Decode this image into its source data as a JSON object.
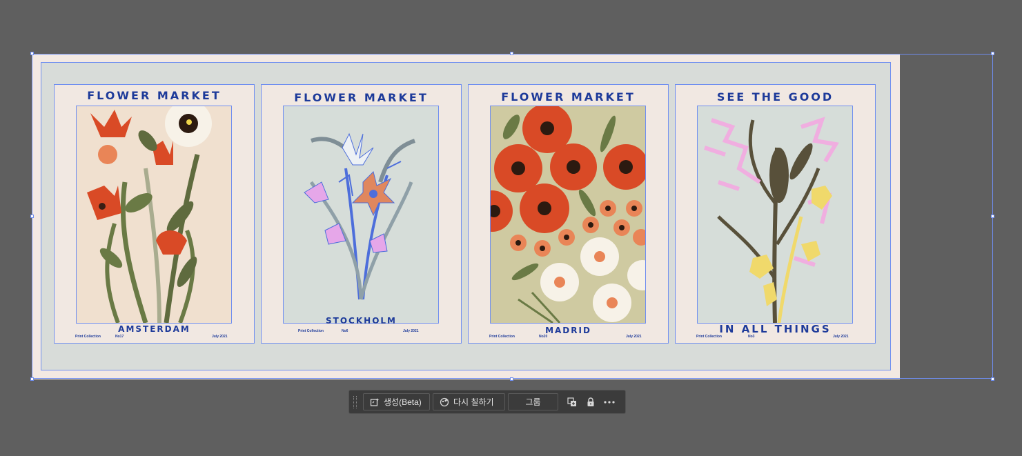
{
  "posters": [
    {
      "title": "FLOWER MARKET",
      "city": "AMSTERDAM",
      "collection": "Print Collection",
      "number": "No17",
      "date": "July 2021"
    },
    {
      "title": "FLOWER MARKET",
      "city": "STOCKHOLM",
      "collection": "Print Collection",
      "number": "No6",
      "date": "July 2021"
    },
    {
      "title": "FLOWER MARKET",
      "city": "MADRID",
      "collection": "Print Collection",
      "number": "No20",
      "date": "July 2021"
    },
    {
      "title": "SEE THE GOOD",
      "city": "IN ALL THINGS",
      "collection": "Print Collection",
      "number": "No3",
      "date": "July 2021"
    }
  ],
  "toolbar": {
    "generate_label": "생성(Beta)",
    "recolor_label": "다시 칠하기",
    "group_label": "그룹",
    "icons": [
      "generate-icon",
      "recolor-icon",
      "arrange-icon",
      "lock-icon",
      "more-icon"
    ]
  },
  "colors": {
    "canvas": "#5f5f5f",
    "selection": "#6f8ef0",
    "title_blue": "#1d3a9a"
  }
}
